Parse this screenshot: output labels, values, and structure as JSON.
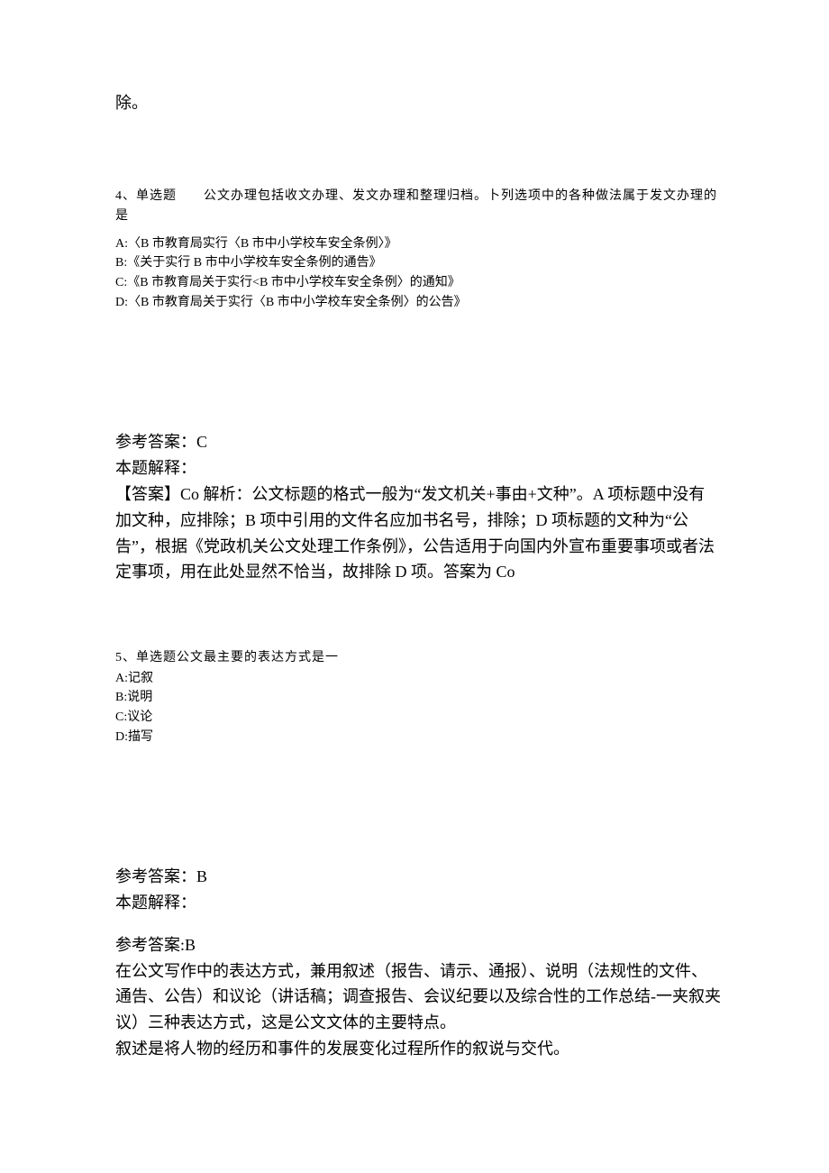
{
  "q3": {
    "tail": "除。"
  },
  "q4": {
    "stem": "4、单选题　　公文办理包括收文办理、发文办理和整理归档。卜列选项中的各种做法属于发文办理的是",
    "optA": "A:〈B 市教育局实行〈B 市中小学校车安全条例〉》",
    "optB": "B:《关于实行 B 市中小学校车安全条例的通告》",
    "optC": "C:《B 市教育局关于实行<B 市中小学校车安全条例〉的通知》",
    "optD": "D:〈B 市教育局关于实行〈B 市中小学校车安全条例〉的公告》",
    "ans_label": "参考答案：C",
    "exp_label": "本题解释：",
    "explanation": "【答案】Co 解析：公文标题的格式一般为“发文机关+事由+文种”。A 项标题中没有加文种，应排除；B 项中引用的文件名应加书名号，排除；D 项标题的文种为“公告”，根据《党政机关公文处理工作条例》，公告适用于向国内外宣布重要事项或者法定事项，用在此处显然不恰当，故排除 D 项。答案为 Co"
  },
  "q5": {
    "stem": "5、单选题公文最主要的表达方式是一",
    "optA": "A:记叙",
    "optB": "B:说明",
    "optC": "C:议论",
    "optD": "D:描写",
    "ans_label": "参考答案：B",
    "exp_label": "本题解释：",
    "ref_label": "参考答案:B",
    "body1": "在公文写作中的表达方式，兼用叙述（报告、请示、通报）、说明（法规性的文件、通告、公告）和议论（讲话稿；调查报告、会议纪要以及综合性的工作总结-一夹叙夹议）三种表达方式，这是公文文体的主要特点。",
    "body2": "叙述是将人物的经历和事件的发展变化过程所作的叙说与交代。"
  }
}
